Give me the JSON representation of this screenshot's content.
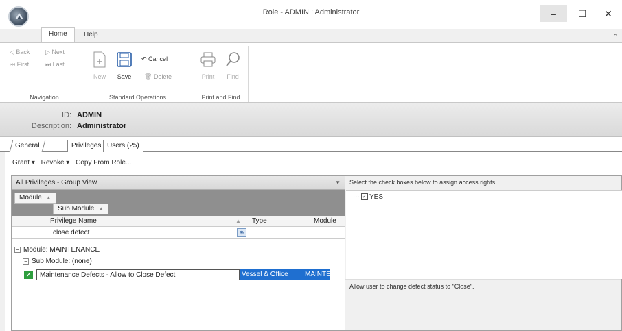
{
  "window": {
    "title": "Role - ADMIN : Administrator",
    "minimize": "–",
    "maximize": "☐",
    "close": "✕"
  },
  "menu": {
    "home": "Home",
    "help": "Help",
    "collapse": "⌃"
  },
  "ribbon": {
    "navigation": {
      "back": "◁ Back",
      "next": "▷ Next",
      "first": "⏮ First",
      "last": "⏭ Last",
      "label": "Navigation"
    },
    "standard": {
      "new": "New",
      "save": "Save",
      "cancel": "Cancel",
      "delete": "Delete",
      "label": "Standard Operations"
    },
    "print_find": {
      "print": "Print",
      "find": "Find",
      "label": "Print and Find"
    }
  },
  "header": {
    "id_label": "ID:",
    "id_value": "ADMIN",
    "desc_label": "Description:",
    "desc_value": "Administrator"
  },
  "tabs": {
    "general": "General",
    "privileges": "Privileges",
    "users": "Users (25)"
  },
  "toolbar": {
    "grant": "Grant ▾",
    "revoke": "Revoke ▾",
    "copy": "Copy From Role..."
  },
  "grid": {
    "view": "All Privileges - Group View",
    "group_module": "Module",
    "group_submodule": "Sub Module",
    "col_name": "Privilege Name",
    "col_type": "Type",
    "col_module": "Module",
    "filter_value": "close defect",
    "group1": "Module: MAINTENANCE",
    "group2": "Sub Module: (none)",
    "row": {
      "name": "Maintenance Defects - Allow to Close Defect",
      "type": "Vessel & Office",
      "module": "MAINTE"
    }
  },
  "rights": {
    "instruction": "Select the check boxes below to assign access rights.",
    "node": "YES",
    "description": "Allow user to change defect status to \"Close\"."
  }
}
